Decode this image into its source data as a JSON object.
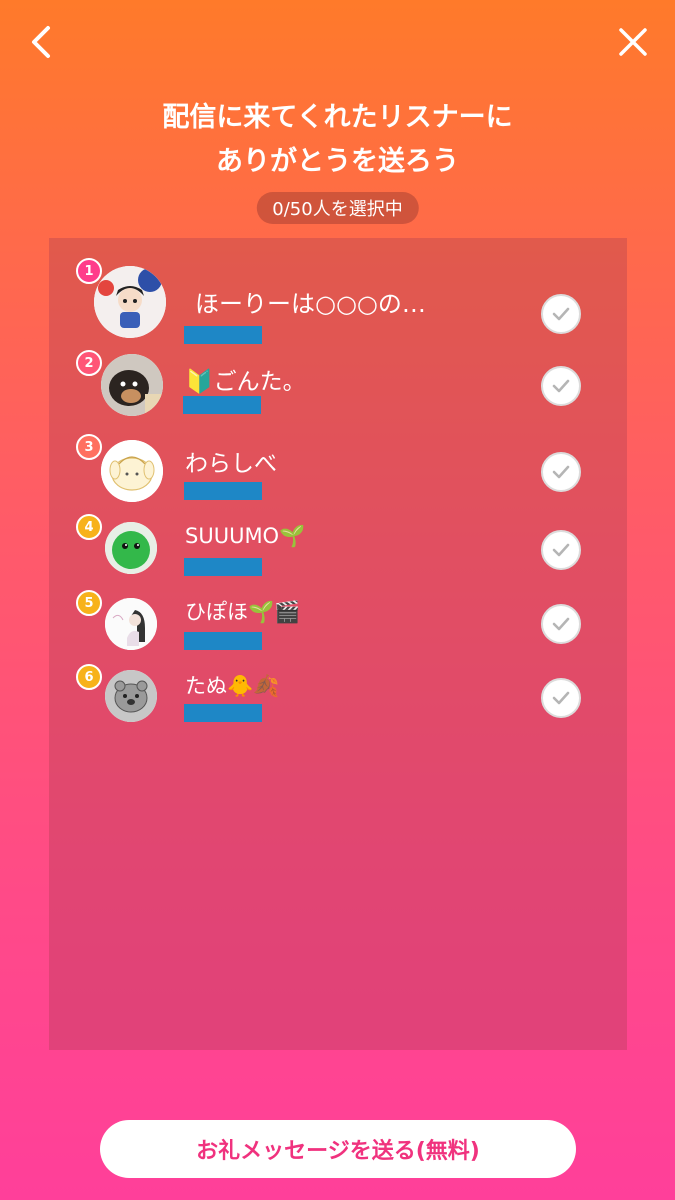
{
  "header": {
    "back_icon": "chevron-left-icon",
    "close_icon": "close-icon",
    "title_line1": "配信に来てくれたリスナーに",
    "title_line2": "ありがとうを送ろう",
    "selection_counter": "0/50人を選択中"
  },
  "listeners": [
    {
      "rank": "1",
      "name": "ほーりーは○○○の…",
      "avatar": "anime-boy-avatar"
    },
    {
      "rank": "2",
      "name": "🔰ごんた。",
      "avatar": "dog-photo-avatar"
    },
    {
      "rank": "3",
      "name": "わらしべ",
      "avatar": "pompompurin-avatar"
    },
    {
      "rank": "4",
      "name": "SUUUMO🌱",
      "avatar": "green-mascot-avatar"
    },
    {
      "rank": "5",
      "name": "ひぽほ🌱🎬",
      "avatar": "girl-sketch-avatar"
    },
    {
      "rank": "6",
      "name": "たぬ🐥🍂",
      "avatar": "tanuki-avatar"
    }
  ],
  "footer": {
    "send_button_label": "お礼メッセージを送る(無料)"
  },
  "colors": {
    "gradient_top": "#ff7a2a",
    "gradient_bottom": "#ff3f9a",
    "redaction_bar": "#1e87c6",
    "cta_text": "#f0327e"
  }
}
